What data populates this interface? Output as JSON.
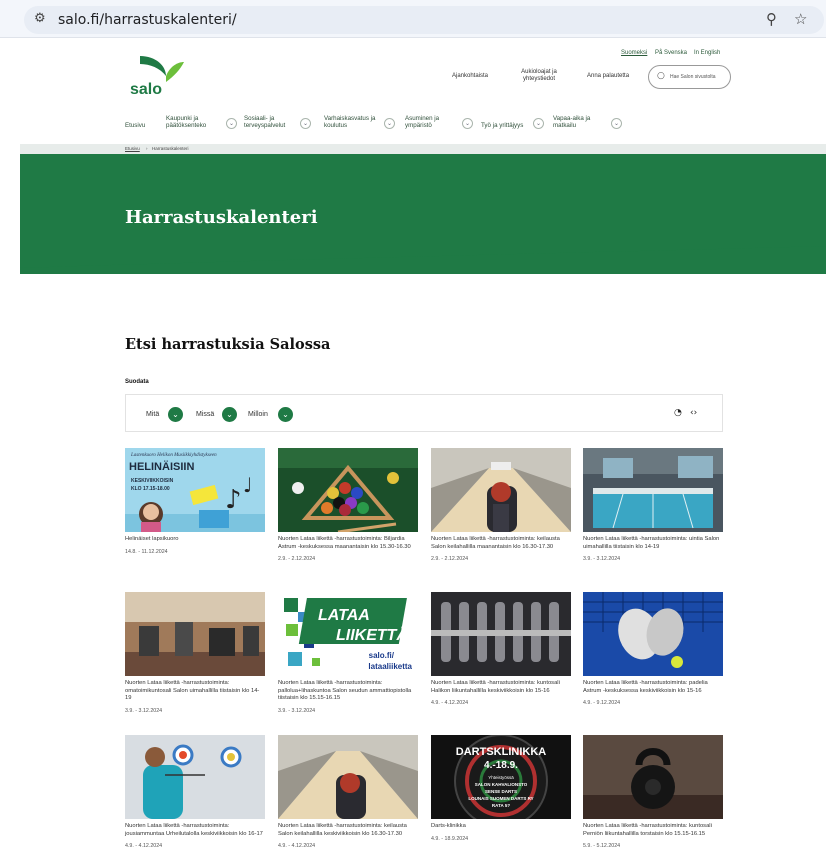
{
  "browser": {
    "url": "salo.fi/harrastuskalenteri/"
  },
  "header": {
    "logo_text": "salo",
    "languages": [
      "Suomeksi",
      "På Svenska",
      "In English"
    ],
    "links": [
      "Ajankohtaista",
      "Aukioloajat ja yhteystiedot",
      "Anna palautetta"
    ],
    "search_placeholder": "Hae Salon sivustolta"
  },
  "nav": {
    "items": [
      "Etusivu",
      "Kaupunki ja päätöksenteko",
      "Sosiaali- ja terveyspalvelut",
      "Varhaiskasvatus ja koulutus",
      "Asuminen ja ympäristö",
      "Työ ja yrittäjyys",
      "Vapaa-aika ja matkailu"
    ]
  },
  "breadcrumb": {
    "home": "Etusivu",
    "sep": "›",
    "current": "Harrastuskalenteri"
  },
  "hero": {
    "title": "Harrastuskalenteri"
  },
  "main": {
    "title": "Etsi harrastuksia Salossa",
    "filter_label": "Suodata",
    "filters": [
      "Mitä",
      "Missä",
      "Milloin"
    ]
  },
  "cards": [
    {
      "title": "Helinäiset lapsikuoro",
      "date": "14.8. - 11.12.2024",
      "image": "helinaiset"
    },
    {
      "title": "Nuorten Lataa liikettä -harrastustoiminta: Biljardia Astrum -keskuksessa maanantaisin klo 15.30-16.30",
      "date": "2.9. - 2.12.2024",
      "image": "billiards"
    },
    {
      "title": "Nuorten Lataa liikettä -harrastustoiminta: keilausta Salon keilahallilla maanantaisin klo 16.30-17.30",
      "date": "2.9. - 2.12.2024",
      "image": "bowling"
    },
    {
      "title": "Nuorten Lataa liikettä -harrastustoiminta: uintia Salon uimahallilla tiistaisin klo 14-19",
      "date": "3.9. - 3.12.2024",
      "image": "pool"
    },
    {
      "title": "Nuorten Lataa liikettä -harrastustoiminta: omatoimikuntosali Salon uimahallilla tiistaisin klo 14-19",
      "date": "3.9. - 3.12.2024",
      "image": "gym"
    },
    {
      "title": "Nuorten Lataa liikettä -harrastustoiminta: pallolua+lihaskuntoa Salon seudun ammattiopistolla tiistaisin klo 15.15-16.15",
      "date": "3.9. - 3.12.2024",
      "image": "lataa",
      "img_text": [
        "LATAA",
        "LIIKETTÄ",
        "salo.fi/",
        "lataaliiketta"
      ]
    },
    {
      "title": "Nuorten Lataa liikettä -harrastustoiminta: kuntosali Halikon liikuntahallilla keskiviikkoisin klo 15-16",
      "date": "4.9. - 4.12.2024",
      "image": "dumbbells"
    },
    {
      "title": "Nuorten Lataa liikettä -harrastustoiminta: padelia Astrum -keskuksessa keskiviikkoisin klo 15-16",
      "date": "4.9. - 9.12.2024",
      "image": "padel"
    },
    {
      "title": "Nuorten Lataa liikettä -harrastustoiminta: jousiammuntaa Urheilutalolla keskiviikkoisin klo 16-17",
      "date": "4.9. - 4.12.2024",
      "image": "archery"
    },
    {
      "title": "Nuorten Lataa liikettä -harrastustoiminta: keilausta Salon keilahallilla keskiviikkoisin klo 16.30-17.30",
      "date": "4.9. - 4.12.2024",
      "image": "bowling2"
    },
    {
      "title": "Darts-klinikka",
      "date": "4.9. - 18.9.2024",
      "image": "darts",
      "img_text": [
        "DARTSKLINIKKA",
        "4.-18.9.",
        "Yhteistyössä",
        "SALON KAHVALIONSTO",
        "SENSE DARTS",
        "LOUNAIS SUOMEN DARTS RY",
        "RATA 5?"
      ]
    },
    {
      "title": "Nuorten Lataa liikettä -harrastustoiminta: kuntosali Perniön liikuntahallilla torstaisin klo 15.15-16.15",
      "date": "5.9. - 5.12.2024",
      "image": "kettlebell"
    }
  ],
  "helinaiset_img": [
    "Lastenkuoro Helikon Musiikkiyhdistykseen",
    "HELINÄISIIN",
    "KESKIVIIKKOISIN",
    "KLO 17.15-18.00"
  ],
  "colors": {
    "brand_green": "#1f7a45",
    "light_green": "#6cbf3b"
  },
  "icons": [
    "tune-icon",
    "zoom-icon",
    "star-icon",
    "search-icon",
    "chevron-down-icon",
    "rss-icon",
    "embed-icon"
  ]
}
